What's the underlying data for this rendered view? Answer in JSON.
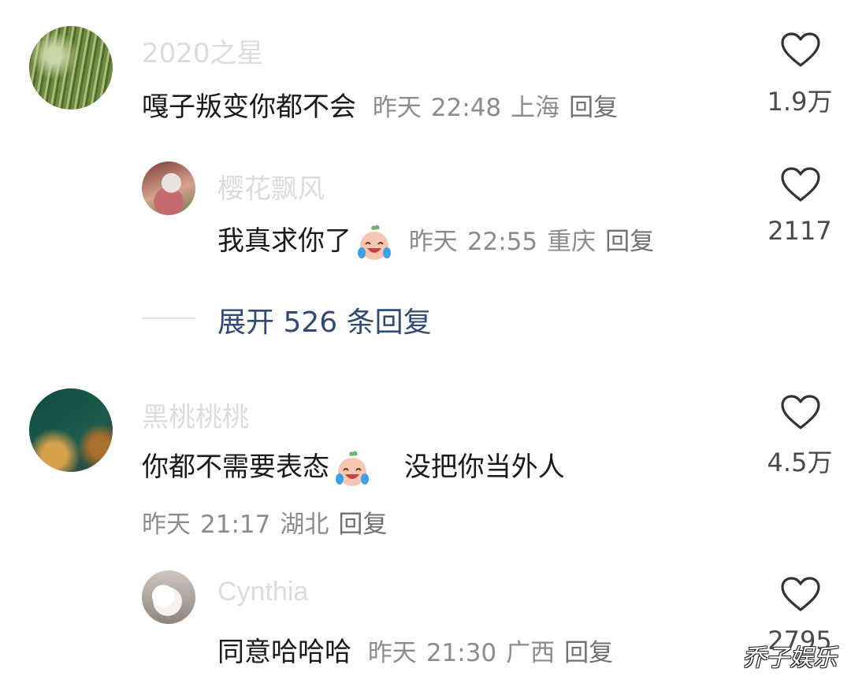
{
  "comments": [
    {
      "username": "2020之星",
      "text": "嘎子叛变你都不会",
      "date": "昨天",
      "time": "22:48",
      "location": "上海",
      "reply_label": "回复",
      "likes": "1.9万",
      "avatar": "grass-avatar"
    },
    {
      "username": "樱花飘风",
      "text": "我真求你了",
      "emoji": "crying-laughing-emoji",
      "date": "昨天",
      "time": "22:55",
      "location": "重庆",
      "reply_label": "回复",
      "likes": "2117",
      "avatar": "doll-avatar"
    },
    {
      "username": "黑桃桃桃",
      "text": "你都不需要表态",
      "emoji": "crying-laughing-emoji",
      "text_after": "没把你当外人",
      "date": "昨天",
      "time": "21:17",
      "location": "湖北",
      "reply_label": "回复",
      "likes": "4.5万",
      "avatar": "gold-leaf-avatar"
    },
    {
      "username": "Cynthia",
      "text": "同意哈哈哈",
      "date": "昨天",
      "time": "21:30",
      "location": "广西",
      "reply_label": "回复",
      "likes": "2795",
      "avatar": "white-dog-avatar"
    }
  ],
  "expand_replies": "展开 526 条回复",
  "watermark": "乔子娱乐",
  "colors": {
    "username": "#dcdcdc",
    "text": "#1a1a1a",
    "meta": "#8c8c8c",
    "expand_link": "#2e4a75"
  }
}
